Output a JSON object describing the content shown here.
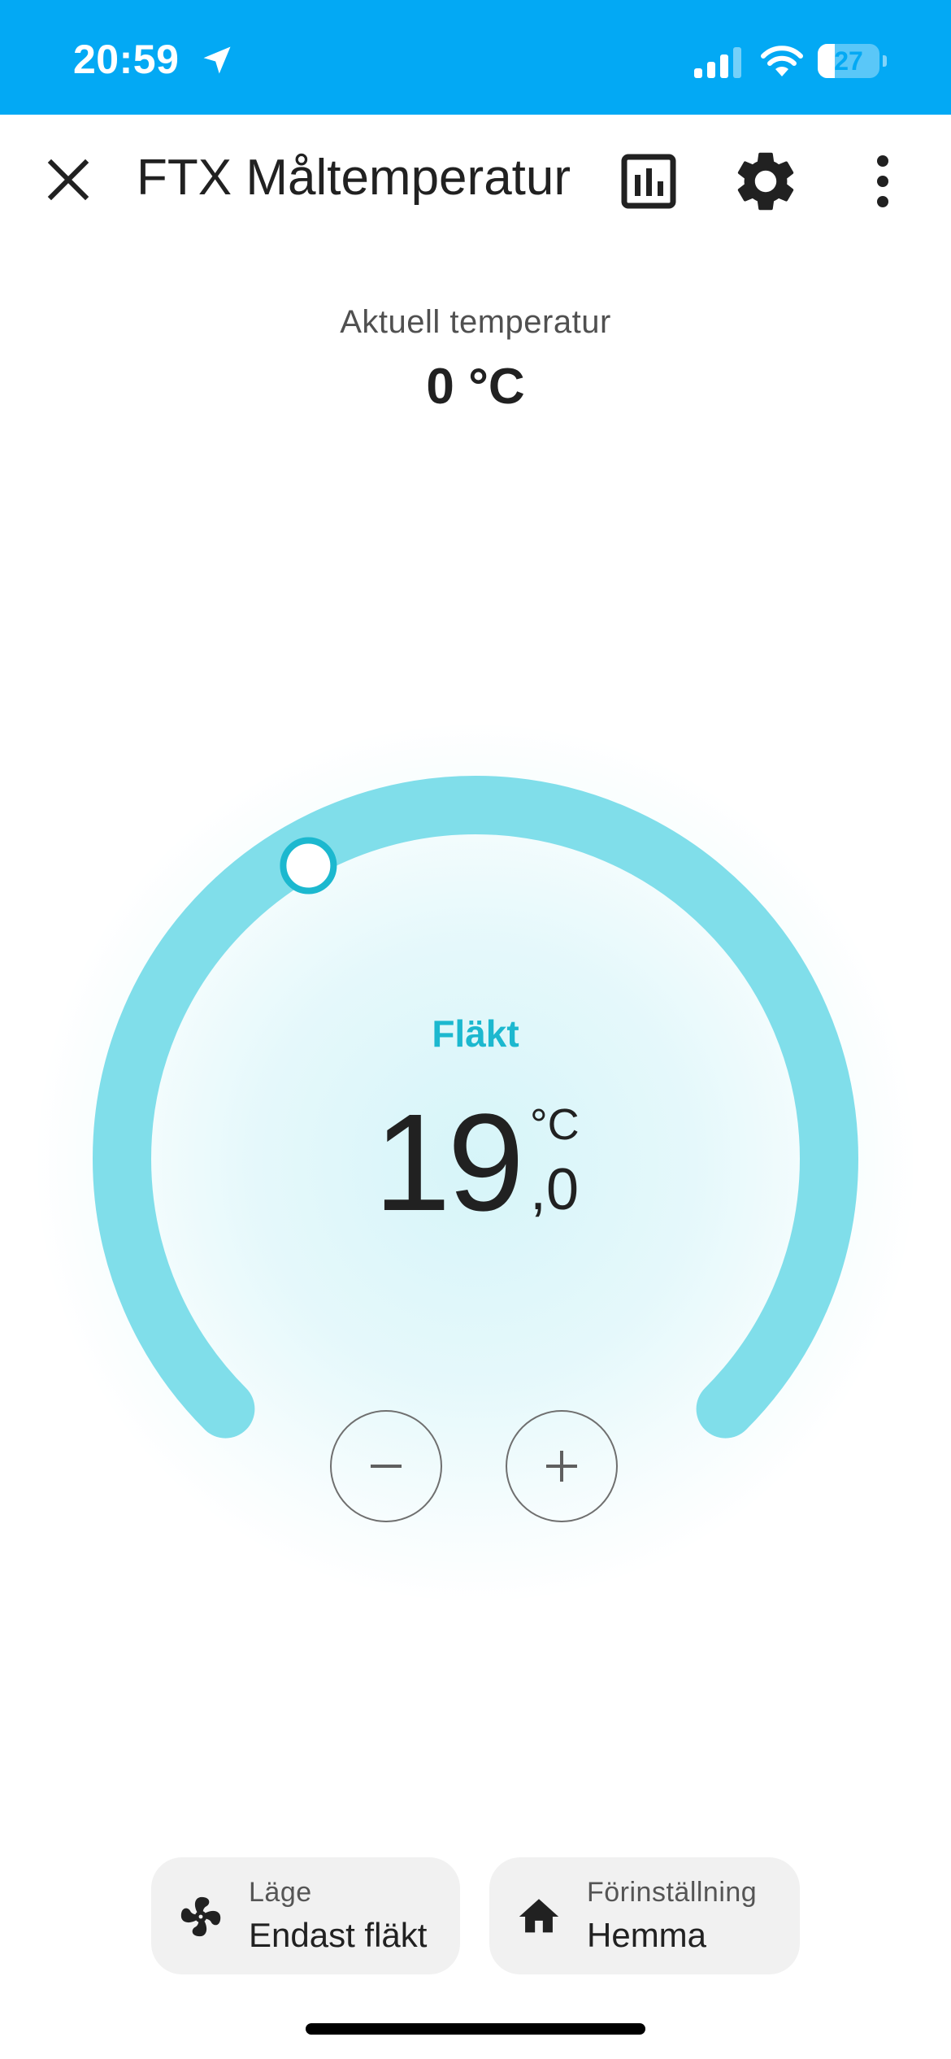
{
  "status_bar": {
    "time": "20:59",
    "battery_level": "27",
    "battery_fraction": 0.27
  },
  "app_bar": {
    "title": "FTX Måltemperatur"
  },
  "current_temperature": {
    "label": "Aktuell temperatur",
    "value": "0 °C"
  },
  "thermostat": {
    "mode_label": "Fläkt",
    "target_integer": "19",
    "target_decimal": ",0",
    "unit": "°C",
    "accent_color": "#80deea",
    "handle_color": "#1cb8cf",
    "slider_fraction": 0.39
  },
  "chips": {
    "mode": {
      "title": "Läge",
      "value": "Endast fläkt",
      "icon": "fan-icon"
    },
    "preset": {
      "title": "Förinställning",
      "value": "Hemma",
      "icon": "home-icon"
    }
  },
  "colors": {
    "status_bar_bg": "#03a9f4",
    "background": "#ffffff",
    "chip_bg": "#f1f1f1"
  }
}
